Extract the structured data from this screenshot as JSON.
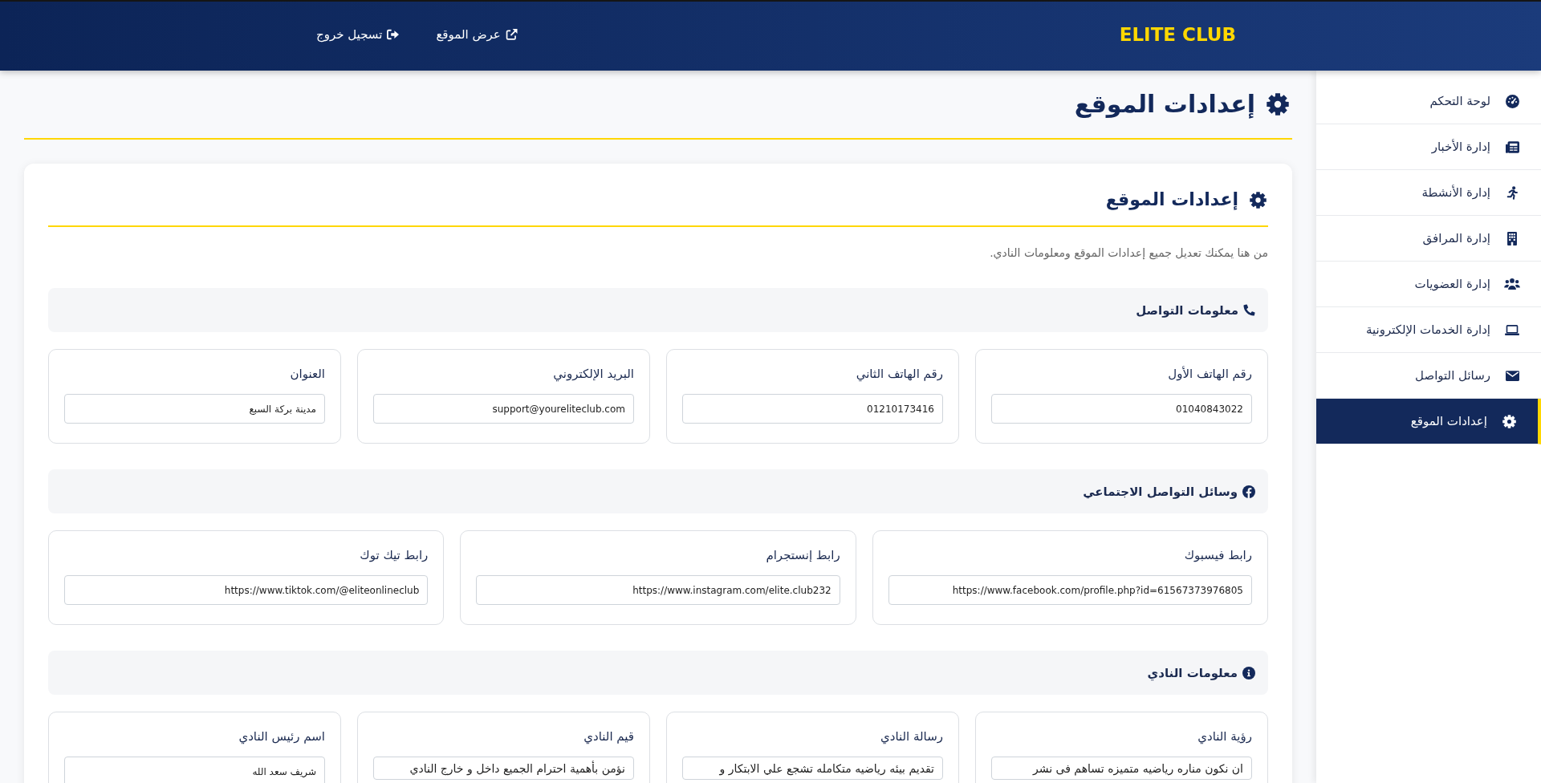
{
  "header": {
    "brand": "ELITE CLUB",
    "links": [
      "عرض الموقع",
      "تسجيل خروج"
    ]
  },
  "sidebar": {
    "items": [
      {
        "label": "لوحة التحكم",
        "selected": false
      },
      {
        "label": "إدارة الأخبار",
        "selected": false
      },
      {
        "label": "إدارة الأنشطة",
        "selected": false
      },
      {
        "label": "إدارة المرافق",
        "selected": false
      },
      {
        "label": "إدارة العضويات",
        "selected": false
      },
      {
        "label": "إدارة الخدمات الإلكترونية",
        "selected": false
      },
      {
        "label": "رسائل التواصل",
        "selected": false
      },
      {
        "label": "إعدادات الموقع",
        "selected": true
      }
    ]
  },
  "page_title": "إعدادات الموقع",
  "settings_card": {
    "title": "إعدادات الموقع",
    "description": "من هنا يمكنك تعديل جميع إعدادات الموقع ومعلومات النادي.",
    "sections": [
      {
        "title": "معلومات التواصل",
        "fields": [
          {
            "label": "رقم الهاتف الأول",
            "value": "01040843022",
            "kind": "input"
          },
          {
            "label": "رقم الهاتف الثاني",
            "value": "01210173416",
            "kind": "input"
          },
          {
            "label": "البريد الإلكتروني",
            "value": "support@youreliteclub.com",
            "kind": "input"
          },
          {
            "label": "العنوان",
            "value": "مدينة بركة السبع",
            "kind": "input"
          }
        ]
      },
      {
        "title": "وسائل التواصل الاجتماعي",
        "fields": [
          {
            "label": "رابط فيسبوك",
            "value": "https://www.facebook.com/profile.php?id=61567373976805",
            "kind": "input"
          },
          {
            "label": "رابط إنستجرام",
            "value": "https://www.instagram.com/elite.club232",
            "kind": "input"
          },
          {
            "label": "رابط تيك توك",
            "value": "https://www.tiktok.com/@eliteonlineclub",
            "kind": "input"
          }
        ]
      },
      {
        "title": "معلومات النادي",
        "fields": [
          {
            "label": "رؤية النادي",
            "value": "ان نكون مناره رياضيه متميزه تساهم فى نشر",
            "kind": "textarea"
          },
          {
            "label": "رسالة النادي",
            "value": "تقديم بيئه رياضيه متكامله تشجع علي الابتكار و",
            "kind": "textarea"
          },
          {
            "label": "قيم النادي",
            "value": "نؤمن بأهمية احترام الجميع داخل و خارج النادي",
            "kind": "textarea"
          },
          {
            "label": "اسم رئيس النادي",
            "value": "شريف سعد الله",
            "kind": "input"
          }
        ]
      }
    ]
  }
}
